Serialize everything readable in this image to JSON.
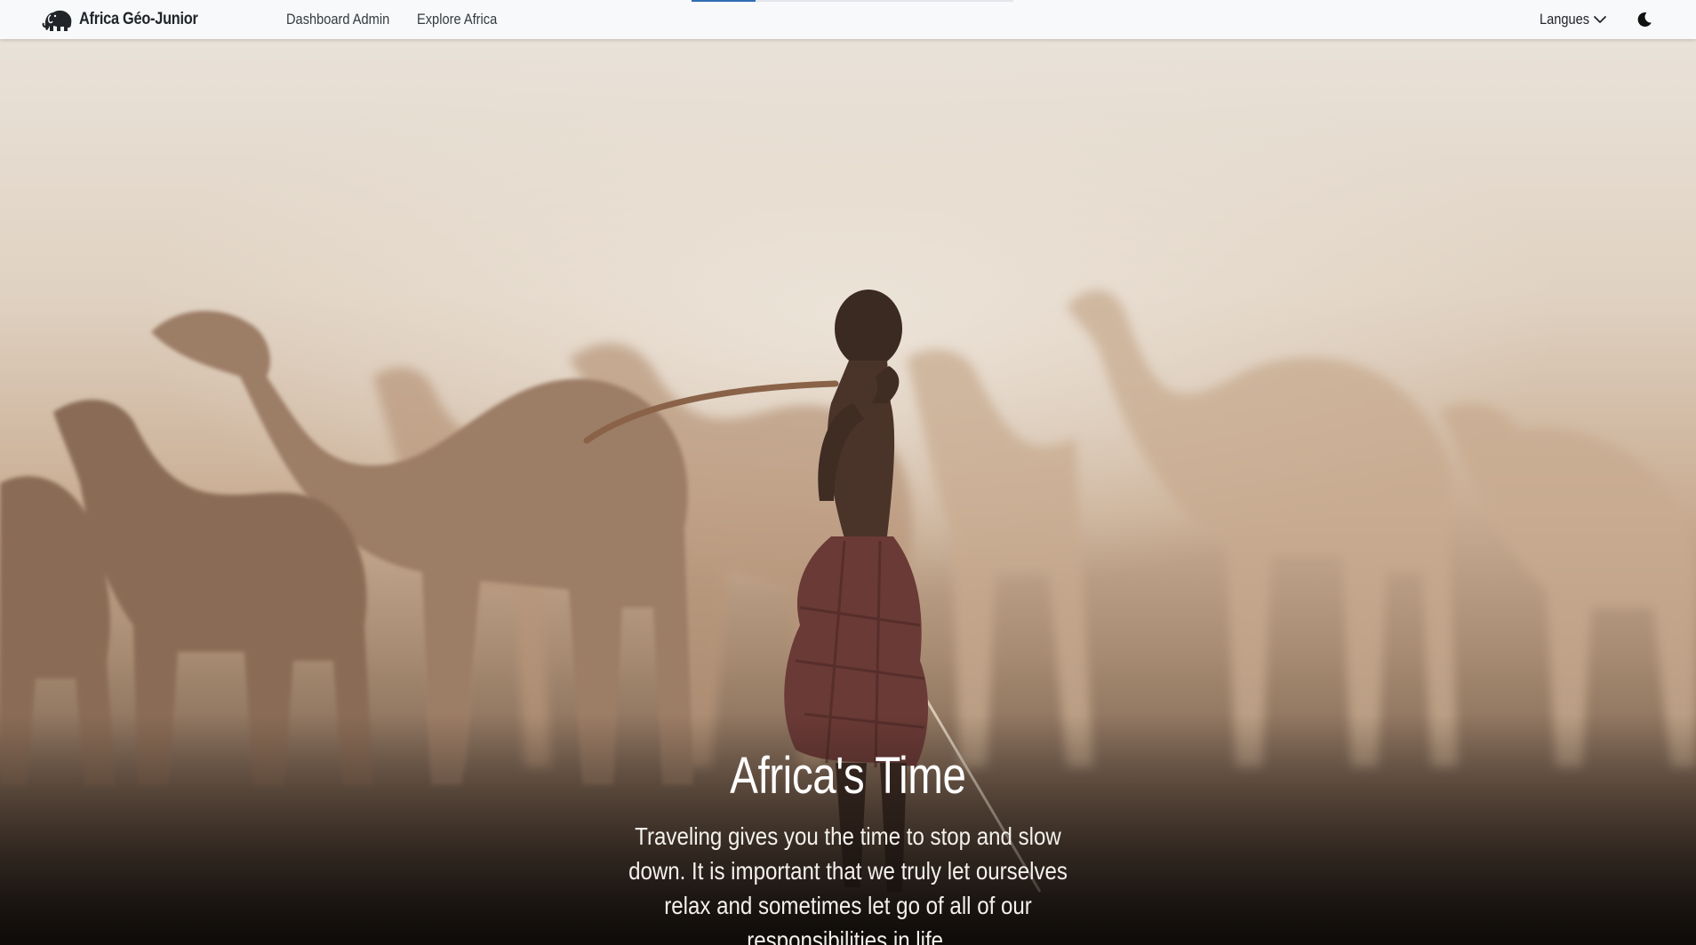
{
  "navbar": {
    "brand": {
      "name": "Africa Géo-Junior",
      "icon": "elephant-icon"
    },
    "links": [
      {
        "label": "Dashboard Admin"
      },
      {
        "label": "Explore Africa"
      }
    ],
    "language_toggle": {
      "label": "Langues",
      "icon": "chevron-down-icon"
    },
    "theme_toggle": {
      "icon": "moon-icon"
    }
  },
  "hero": {
    "title": "Africa's Time",
    "text": "Traveling gives you the time to stop and slow down. It is important that we truly let ourselves relax and sometimes let go of all of our responsibilities in life.",
    "image": "boy-with-camel-herd-photo"
  },
  "colors": {
    "navbar_bg": "#f8f9fa",
    "accent": "#2f6fb3",
    "hero_text": "#ffffff"
  }
}
